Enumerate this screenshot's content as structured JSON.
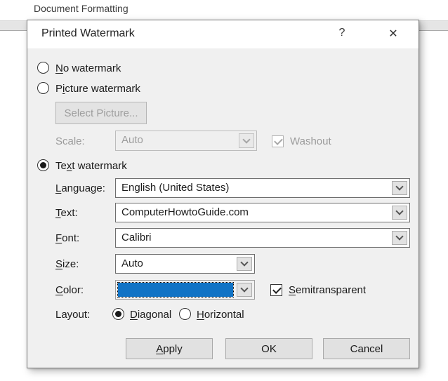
{
  "background": {
    "ribbon_tab": "Document Formatting"
  },
  "dialog": {
    "title": "Printed Watermark",
    "help_glyph": "?",
    "close_glyph": "✕"
  },
  "options": {
    "no_watermark": {
      "pre": "",
      "key": "N",
      "post": "o watermark",
      "selected": false
    },
    "picture_watermark": {
      "pre": "P",
      "key": "i",
      "post": "cture watermark",
      "selected": false
    },
    "text_watermark": {
      "pre": "Te",
      "key": "x",
      "post": "t watermark",
      "selected": true
    }
  },
  "picture_section": {
    "select_picture_button": "Select Picture...",
    "scale_label": "Scale:",
    "scale_value": "Auto",
    "washout_label": "Washout",
    "washout_checked": true,
    "enabled": false
  },
  "text_section": {
    "language": {
      "pre": "",
      "key": "L",
      "post": "anguage:",
      "value": "English (United States)"
    },
    "text": {
      "pre": "",
      "key": "T",
      "post": "ext:",
      "value": "ComputerHowtoGuide.com"
    },
    "font": {
      "pre": "",
      "key": "F",
      "post": "ont:",
      "value": "Calibri"
    },
    "size": {
      "pre": "",
      "key": "S",
      "post": "ize:",
      "value": "Auto"
    },
    "color": {
      "pre": "",
      "key": "C",
      "post": "olor:",
      "value_color": "#1173C5"
    },
    "semitransparent": {
      "pre": "",
      "key": "S",
      "post": "emitransparent",
      "checked": true
    },
    "layout_label": "Layout:",
    "diagonal": {
      "pre": "",
      "key": "D",
      "post": "iagonal",
      "selected": true
    },
    "horizontal": {
      "pre": "",
      "key": "H",
      "post": "orizontal",
      "selected": false
    }
  },
  "footer": {
    "apply": {
      "pre": "",
      "key": "A",
      "post": "pply"
    },
    "ok": "OK",
    "cancel": "Cancel"
  },
  "colors": {
    "watermark_color": "#1173C5",
    "dialog_body": "#f0f0f0",
    "titlebar": "#ffffff"
  }
}
